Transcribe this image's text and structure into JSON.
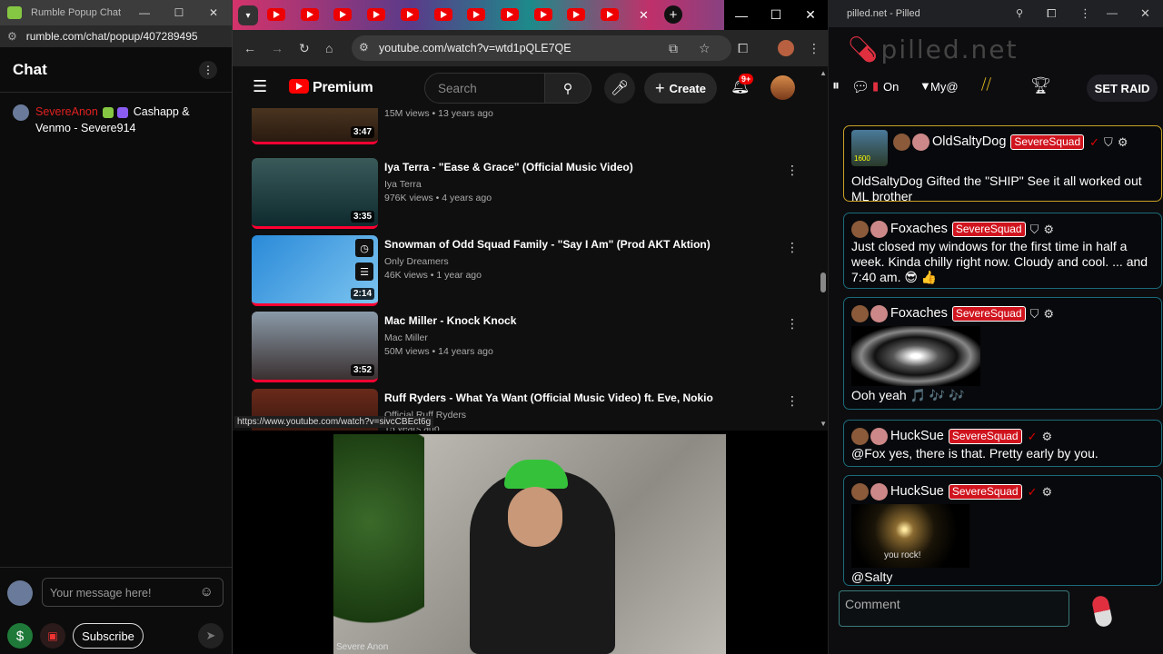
{
  "rumble": {
    "tab_title": "Rumble Popup Chat",
    "url": "rumble.com/chat/popup/407289495",
    "chat_title": "Chat",
    "message": {
      "user": "SevereAnon",
      "text": "Cashapp & Venmo - Severe914"
    },
    "input_placeholder": "Your message here!",
    "subscribe": "Subscribe"
  },
  "chrome": {
    "url": "youtube.com/watch?v=wtd1pQLE7QE",
    "status_url": "https://www.youtube.com/watch?v=sivcCBEct6g"
  },
  "youtube": {
    "logo": "Premium",
    "search_placeholder": "Search",
    "create": "Create",
    "notif_count": "9+",
    "videos": [
      {
        "title": "",
        "channel": "",
        "meta": "15M views • 13 years ago",
        "duration": "3:47"
      },
      {
        "title": "Iya Terra - \"Ease & Grace\" (Official Music Video)",
        "channel": "Iya Terra",
        "meta": "976K views • 4 years ago",
        "duration": "3:35"
      },
      {
        "title": "Snowman of Odd Squad Family - \"Say I Am\" (Prod AKT Aktion)",
        "channel": "Only Dreamers",
        "meta": "46K views • 1 year ago",
        "duration": "2:14"
      },
      {
        "title": "Mac Miller - Knock Knock",
        "channel": "Mac Miller",
        "meta": "50M views • 14 years ago",
        "duration": "3:52"
      },
      {
        "title": "Ruff Ryders - What Ya Want (Official Music Video) ft. Eve, Nokio",
        "channel": "Official Ruff Ryders",
        "meta": "15 years ago",
        "duration": ""
      }
    ]
  },
  "webcam": {
    "label": "Severe Anon"
  },
  "pilled": {
    "tab_title": "pilled.net - Pilled",
    "logo": "pilled.net",
    "on": "On",
    "my": "My@",
    "set_raid": "SET RAID",
    "cards": [
      {
        "user": "OldSaltyDog",
        "tag": "SevereSquad",
        "text": "OldSaltyDog Gifted the \"SHIP\" See it all worked out ML brother",
        "level": "1600"
      },
      {
        "user": "Foxaches",
        "tag": "SevereSquad",
        "text": "Just closed my windows for the first time in half a week. Kinda chilly right now. Cloudy and cool. ... and 7:40 am. 😎 👍"
      },
      {
        "user": "Foxaches",
        "tag": "SevereSquad",
        "text": "Ooh yeah 🎵 🎶 🎶"
      },
      {
        "user": "HuckSue",
        "tag": "SevereSquad",
        "text": "@Fox yes, there is that. Pretty early by you."
      },
      {
        "user": "HuckSue",
        "tag": "SevereSquad",
        "text": "@Salty",
        "img_text": "you rock!"
      }
    ],
    "comment_placeholder": "Comment"
  },
  "colors": {
    "rumble_red": "#e02020",
    "yt_red": "#ff0000",
    "tag_red": "#d0141e",
    "card_border": "#1a6b7a",
    "gold_border": "#c9a227"
  }
}
